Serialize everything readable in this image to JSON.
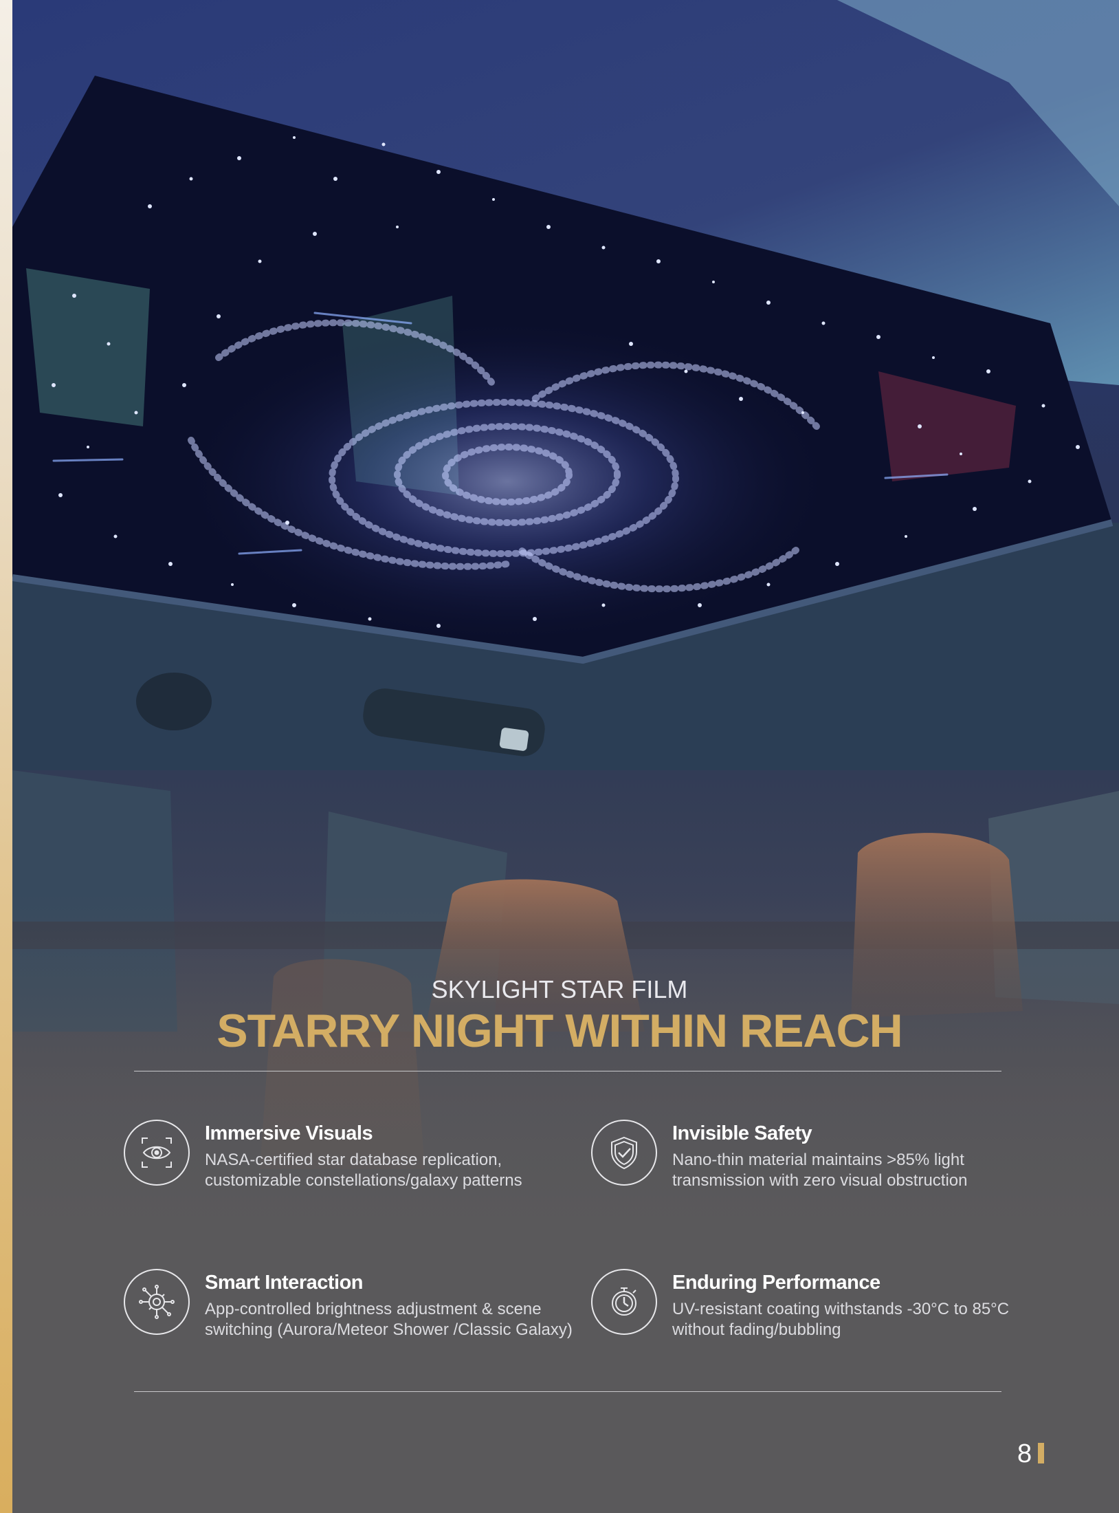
{
  "section": {
    "eyebrow": "SKYLIGHT STAR FILM",
    "headline": "STARRY NIGHT WITHIN REACH"
  },
  "features": [
    {
      "title": "Immersive Visuals",
      "description": "NASA-certified star database replication, customizable constellations/galaxy patterns",
      "icon": "eye-target-icon"
    },
    {
      "title": "Invisible Safety",
      "description": "Nano-thin material maintains >85% light transmission with zero visual obstruction",
      "icon": "shield-check-icon"
    },
    {
      "title": "Smart Interaction",
      "description": "App-controlled brightness adjustment & scene switching (Aurora/Meteor Shower /Classic Galaxy)",
      "icon": "circuit-gear-icon"
    },
    {
      "title": "Enduring Performance",
      "description": "UV-resistant coating withstands -30°C to 85°C without fading/bubbling",
      "icon": "stopwatch-icon"
    }
  ],
  "page": {
    "number": "8"
  },
  "colors": {
    "accent_gold": "#d3ad64",
    "background": "#5a595b",
    "text_white": "#ffffff"
  }
}
